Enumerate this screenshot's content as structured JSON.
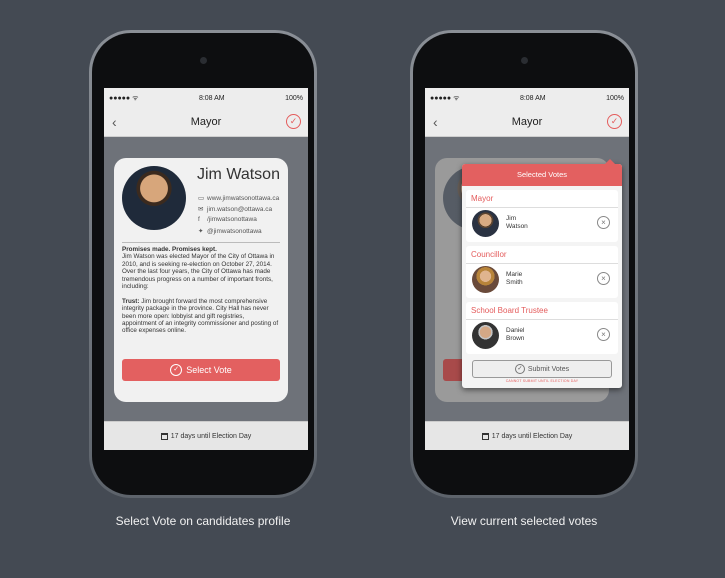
{
  "status": {
    "carrier": "●●●●● ᯤ",
    "time": "8:08 AM",
    "battery": "100%"
  },
  "nav": {
    "title": "Mayor",
    "back": "‹",
    "check": "✓"
  },
  "candidate": {
    "name": "Jim Watson",
    "website": "www.jimwatsonottawa.ca",
    "email": "jim.watson@ottawa.ca",
    "facebook": "/jimwatsonottawa",
    "twitter": "@jimwatsonottawa",
    "bio_heading": "Promises made. Promises kept.",
    "bio_text": "Jim Watson was elected Mayor of the City of Ottawa in 2010, and is seeking re-election on October 27, 2014. Over the last four years, the City of Ottawa has made tremendous progress on a number of important fronts, including:",
    "trust_label": "Trust:",
    "trust_text": " Jim brought forward the most comprehensive integrity package in the province. City Hall has never been more open: lobbyist and gift registries, appointment of an integrity commissioner and posting of office expenses online."
  },
  "select_vote_label": "Select Vote",
  "countdown": "17 days until Election Day",
  "popover": {
    "title": "Selected Votes",
    "sections": [
      {
        "title": "Mayor",
        "first": "Jim",
        "last": "Watson"
      },
      {
        "title": "Councillor",
        "first": "Marie",
        "last": "Smith"
      },
      {
        "title": "School Board Trustee",
        "first": "Daniel",
        "last": "Brown"
      }
    ],
    "submit_label": "Submit Votes",
    "note": "CANNOT SUBMIT UNTIL ELECTION DAY"
  },
  "captions": {
    "left": "Select Vote on candidates profile",
    "right": "View current selected votes"
  },
  "colors": {
    "accent": "#e36060",
    "background": "#444a53"
  }
}
